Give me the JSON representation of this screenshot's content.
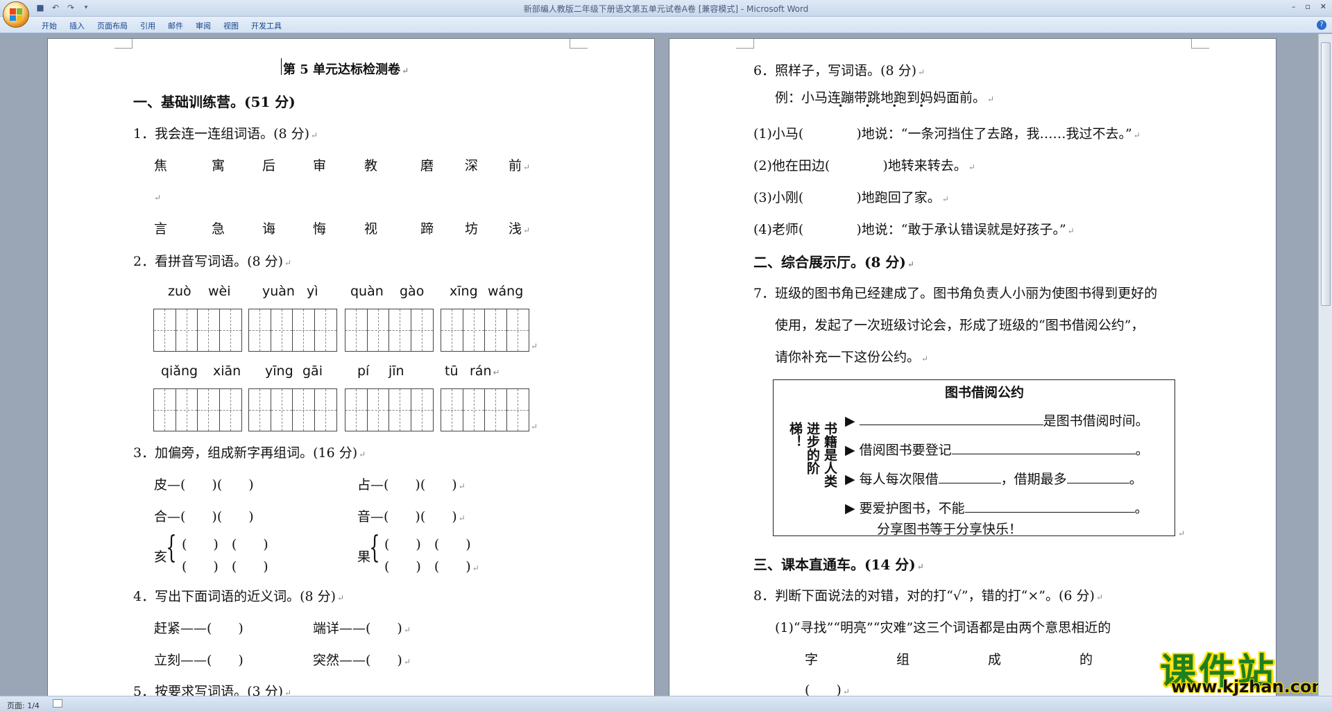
{
  "window": {
    "title": "新部编人教版二年级下册语文第五单元试卷A卷 [兼容模式] - Microsoft Word",
    "controls": [
      "–",
      "▫",
      "✕"
    ]
  },
  "ribbon": {
    "tabs": [
      "开始",
      "插入",
      "页面布局",
      "引用",
      "邮件",
      "审阅",
      "视图",
      "开发工具"
    ]
  },
  "status": {
    "page": "页面: 1/4"
  },
  "doc_left": {
    "title": "第 5 单元达标检测卷",
    "sec1": "一、基础训练营。(51 分)",
    "q1": "1．我会连一连组词语。(8 分)",
    "row1": [
      "焦",
      "寓",
      "后",
      "审",
      "教",
      "磨",
      "深",
      "前"
    ],
    "row2": [
      "言",
      "急",
      "诲",
      "悔",
      "视",
      "蹄",
      "坊",
      "浅"
    ],
    "q2": "2．看拼音写词语。(8 分)",
    "pinyin1": [
      "zuò",
      "wèi",
      "yuàn",
      "yì",
      "quàn",
      "gào",
      "xīng",
      "wáng"
    ],
    "pinyin2": [
      "qiǎng",
      "xiān",
      "yīng",
      "gāi",
      "pí",
      "jīn",
      "tū",
      "rán"
    ],
    "q3": "3．加偏旁，组成新字再组词。(16 分)",
    "q3a": "皮—(　　)(　　)",
    "q3b": "占—(　　)(　　)",
    "q3c": "合—(　　)(　　)",
    "q3d": "音—(　　)(　　)",
    "q3e_char": "亥",
    "q3f_char": "果",
    "q3_blank": "(　　)　(　　)",
    "q4": "4．写出下面词语的近义词。(8 分)",
    "q4a": "赶紧——(　　)",
    "q4b": "端详——(　　)",
    "q4c": "立刻——(　　)",
    "q4d": "突然——(　　)",
    "q5": "5．按要求写词语。(3 分)"
  },
  "doc_right": {
    "q6": "6．照样子，写词语。(8 分)",
    "q6_ex": "例：小马连蹦带跳地跑到妈妈面前。",
    "q6_dots": "• • • •",
    "q6_1": "(1)小马(　　　　)地说：“一条河挡住了去路，我……我过不去。”",
    "q6_2": "(2)他在田边(　　　　)地转来转去。",
    "q6_3": "(3)小刚(　　　　)地跑回了家。",
    "q6_4": "(4)老师(　　　　)地说：“敢于承认错误就是好孩子。”",
    "sec2": "二、综合展示厅。(8 分)",
    "q7_l1": "7．班级的图书角已经建成了。图书角负责人小丽为使图书得到更好的",
    "q7_l2": "使用，发起了一次班级讨论会，形成了班级的“图书借阅公约”，",
    "q7_l3": "请你补充一下这份公约。",
    "box_title": "图书借阅公约",
    "box_side": "书籍是人类进步的阶梯！",
    "box_r1_tail": "是图书借阅时间。",
    "box_r2": "借阅图书要登记",
    "box_r3a": "每人每次限借",
    "box_r3b": "，借期最多",
    "box_r4": "要爱护图书，不能",
    "box_footer": "分享图书等于分享快乐！",
    "sec3": "三、课本直通车。(14 分)",
    "q8": "8．判断下面说法的对错，对的打“√”，错的打“×”。(6 分)",
    "q8_1": "(1)“寻找”“明亮”“灾难”这三个词语都是由两个意思相近的",
    "q8_1b": [
      "字",
      "组",
      "成",
      "的"
    ],
    "q8_1c": "(　　)"
  },
  "watermark": {
    "name": "课件站",
    "url": "www.kjzhan.com"
  }
}
